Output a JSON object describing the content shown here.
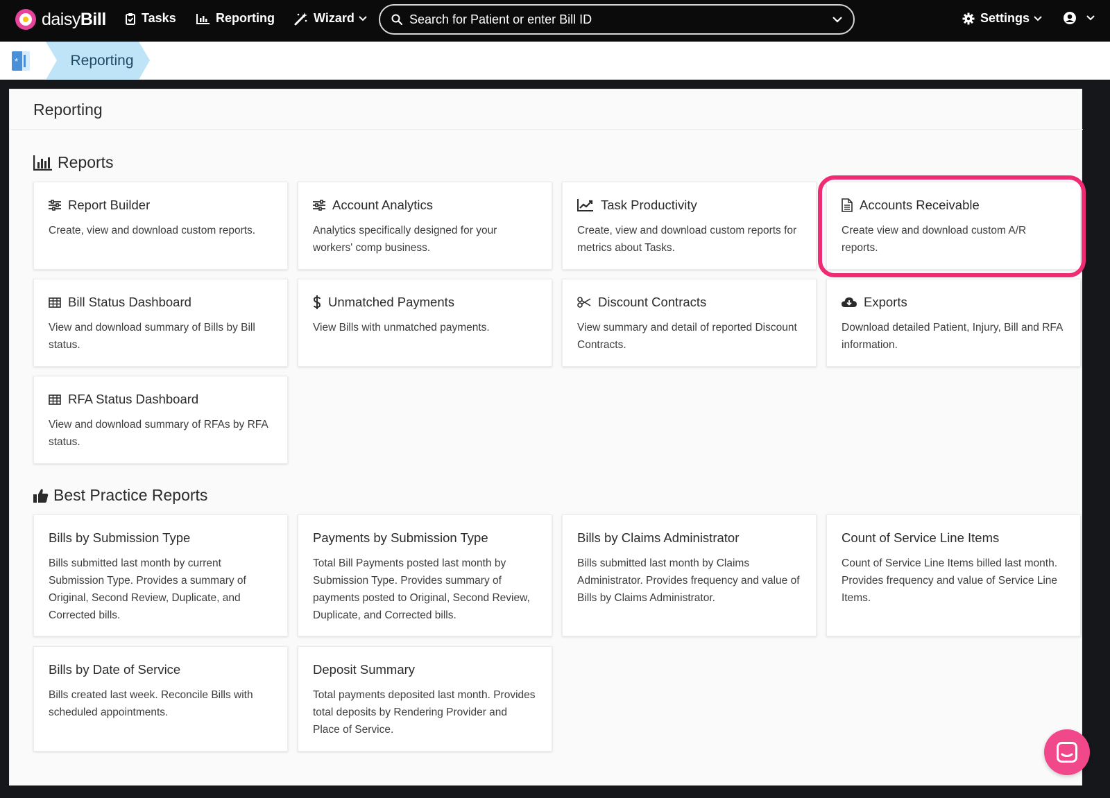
{
  "nav": {
    "logo_prefix": "daisy",
    "logo_bold": "Bill",
    "tasks_label": "Tasks",
    "reporting_label": "Reporting",
    "wizard_label": "Wizard",
    "search_placeholder": "Search for Patient or enter Bill ID",
    "settings_label": "Settings"
  },
  "breadcrumb": {
    "active_label": "Reporting"
  },
  "page": {
    "title": "Reporting"
  },
  "reports": {
    "title": "Reports",
    "cards": [
      {
        "title": "Report Builder",
        "desc": "Create, view and download custom reports.",
        "icon": "sliders-icon"
      },
      {
        "title": "Account Analytics",
        "desc": "Analytics specifically designed for your workers' comp business.",
        "icon": "sliders-icon"
      },
      {
        "title": "Task Productivity",
        "desc": "Create, view and download custom reports for metrics about Tasks.",
        "icon": "line-chart-icon"
      },
      {
        "title": "Accounts Receivable",
        "desc": "Create view and download custom A/R reports.",
        "icon": "document-icon"
      },
      {
        "title": "Bill Status Dashboard",
        "desc": "View and download summary of Bills by Bill status.",
        "icon": "table-icon"
      },
      {
        "title": "Unmatched Payments",
        "desc": "View Bills with unmatched payments.",
        "icon": "dollar-icon"
      },
      {
        "title": "Discount Contracts",
        "desc": "View summary and detail of reported Discount Contracts.",
        "icon": "scissors-icon"
      },
      {
        "title": "Exports",
        "desc": "Download detailed Patient, Injury, Bill and RFA information.",
        "icon": "cloud-download-icon"
      },
      {
        "title": "RFA Status Dashboard",
        "desc": "View and download summary of RFAs by RFA status.",
        "icon": "table-icon"
      }
    ]
  },
  "best_practice": {
    "title": "Best Practice Reports",
    "cards": [
      {
        "title": "Bills by Submission Type",
        "desc": "Bills submitted last month by current Submission Type. Provides a summary of Original, Second Review, Duplicate, and Corrected bills."
      },
      {
        "title": "Payments by Submission Type",
        "desc": "Total Bill Payments posted last month by Submission Type. Provides summary of payments posted to Original, Second Review, Duplicate, and Corrected bills."
      },
      {
        "title": "Bills by Claims Administrator",
        "desc": "Bills submitted last month by Claims Administrator. Provides frequency and value of Bills by Claims Administrator."
      },
      {
        "title": "Count of Service Line Items",
        "desc": "Count of Service Line Items billed last month. Provides frequency and value of Service Line Items."
      },
      {
        "title": "Bills by Date of Service",
        "desc": "Bills created last week. Reconcile Bills with scheduled appointments."
      },
      {
        "title": "Deposit Summary",
        "desc": "Total payments deposited last month. Provides total deposits by Rendering Provider and Place of Service."
      }
    ]
  },
  "colors": {
    "accent_pink": "#ee2b73",
    "breadcrumb_blue": "#bfe3f7",
    "nav_bg": "#0b0b0c"
  }
}
